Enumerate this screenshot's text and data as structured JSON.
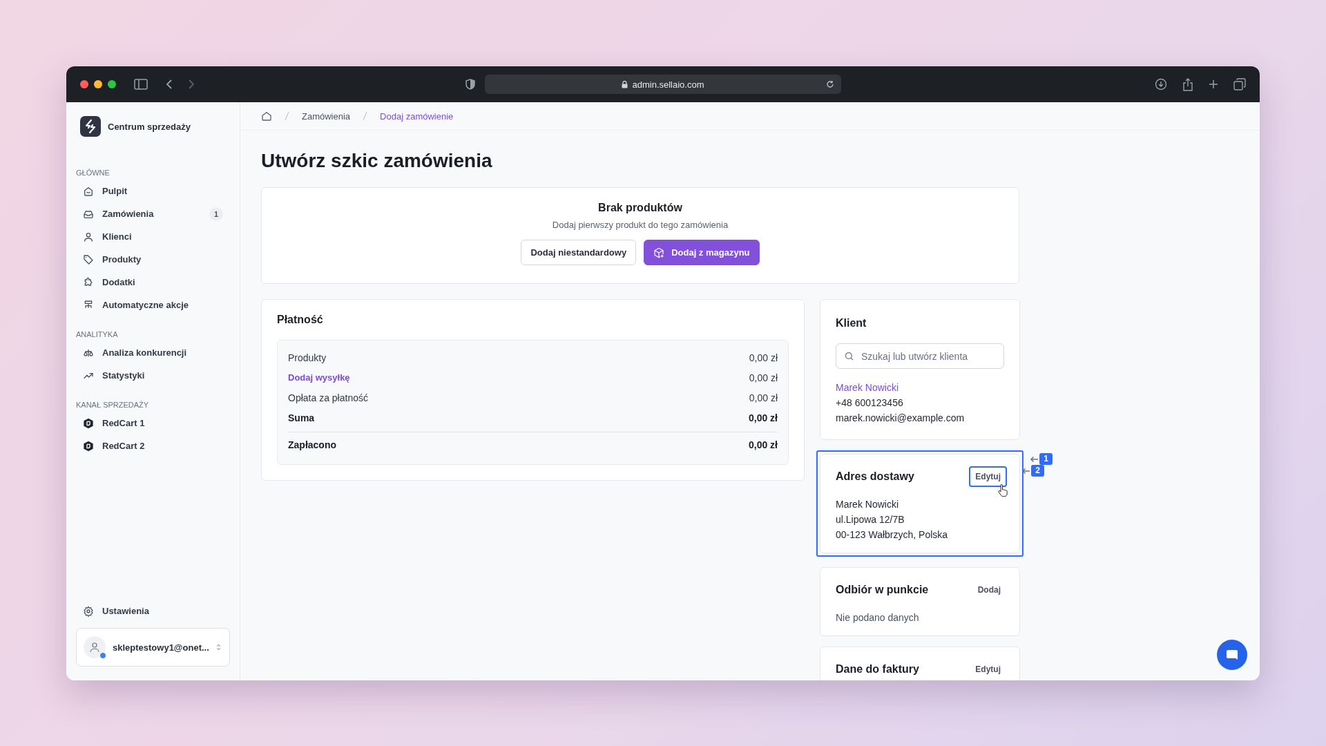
{
  "browser": {
    "url": "admin.sellaio.com"
  },
  "sidebar": {
    "brand": "Centrum sprzedaży",
    "sections": [
      {
        "heading": "GŁÓWNE",
        "items": [
          {
            "label": "Pulpit",
            "selected": false
          },
          {
            "label": "Zamówienia",
            "badge": "1",
            "selected": false
          },
          {
            "label": "Klienci",
            "selected": false
          },
          {
            "label": "Produkty",
            "selected": false
          },
          {
            "label": "Dodatki",
            "selected": false
          },
          {
            "label": "Automatyczne akcje",
            "selected": false
          }
        ]
      },
      {
        "heading": "ANALITYKA",
        "items": [
          {
            "label": "Analiza konkurencji",
            "selected": false
          },
          {
            "label": "Statystyki",
            "selected": false
          }
        ]
      },
      {
        "heading": "KANAŁ SPRZEDAŻY",
        "items": [
          {
            "label": "RedCart 1",
            "selected": false
          },
          {
            "label": "RedCart 2",
            "selected": false
          }
        ]
      }
    ],
    "settings": "Ustawienia",
    "account": {
      "email": "skleptestowy1@onet...",
      "online": true
    }
  },
  "breadcrumb": [
    {
      "label": "Zamówienia",
      "current": false
    },
    {
      "label": "Dodaj zamówienie",
      "current": true
    }
  ],
  "title": "Utwórz szkic zamówienia",
  "products": {
    "title": "Brak produktów",
    "subtitle": "Dodaj pierwszy produkt do tego zamówienia",
    "buttons": [
      {
        "label": "Dodaj niestandardowy",
        "kind": "secondary"
      },
      {
        "label": "Dodaj z magazynu",
        "kind": "primary"
      }
    ]
  },
  "payment": {
    "title": "Płatność",
    "rows": [
      {
        "label": "Produkty",
        "value": "0,00 zł",
        "kind": "plain"
      },
      {
        "label": "Dodaj wysyłkę",
        "value": "0,00 zł",
        "kind": "link"
      },
      {
        "label": "Opłata za płatność",
        "value": "0,00 zł",
        "kind": "plain"
      },
      {
        "label": "Suma",
        "value": "0,00 zł",
        "kind": "total"
      },
      {
        "label": "Zapłacono",
        "value": "0,00 zł",
        "kind": "paid"
      }
    ]
  },
  "client": {
    "title": "Klient",
    "search": {
      "placeholder": "Szukaj lub utwórz klienta"
    },
    "name": "Marek Nowicki",
    "phone": "+48 600123456",
    "email": "marek.nowicki@example.com"
  },
  "cards": [
    {
      "title": "Adres dostawy",
      "action": "Edytuj",
      "highlighted": true,
      "action_highlighted": true,
      "lines": [
        "Marek Nowicki",
        "ul.Lipowa 12/7B",
        "00-123 Wałbrzych, Polska"
      ]
    },
    {
      "title": "Odbiór w punkcie",
      "action": "Dodaj",
      "highlighted": false,
      "action_highlighted": false,
      "lines": [
        "Nie podano danych"
      ]
    },
    {
      "title": "Dane do faktury",
      "action": "Edytuj",
      "highlighted": false,
      "action_highlighted": false
    }
  ],
  "annotations": [
    {
      "label": "1"
    },
    {
      "label": "2"
    }
  ]
}
